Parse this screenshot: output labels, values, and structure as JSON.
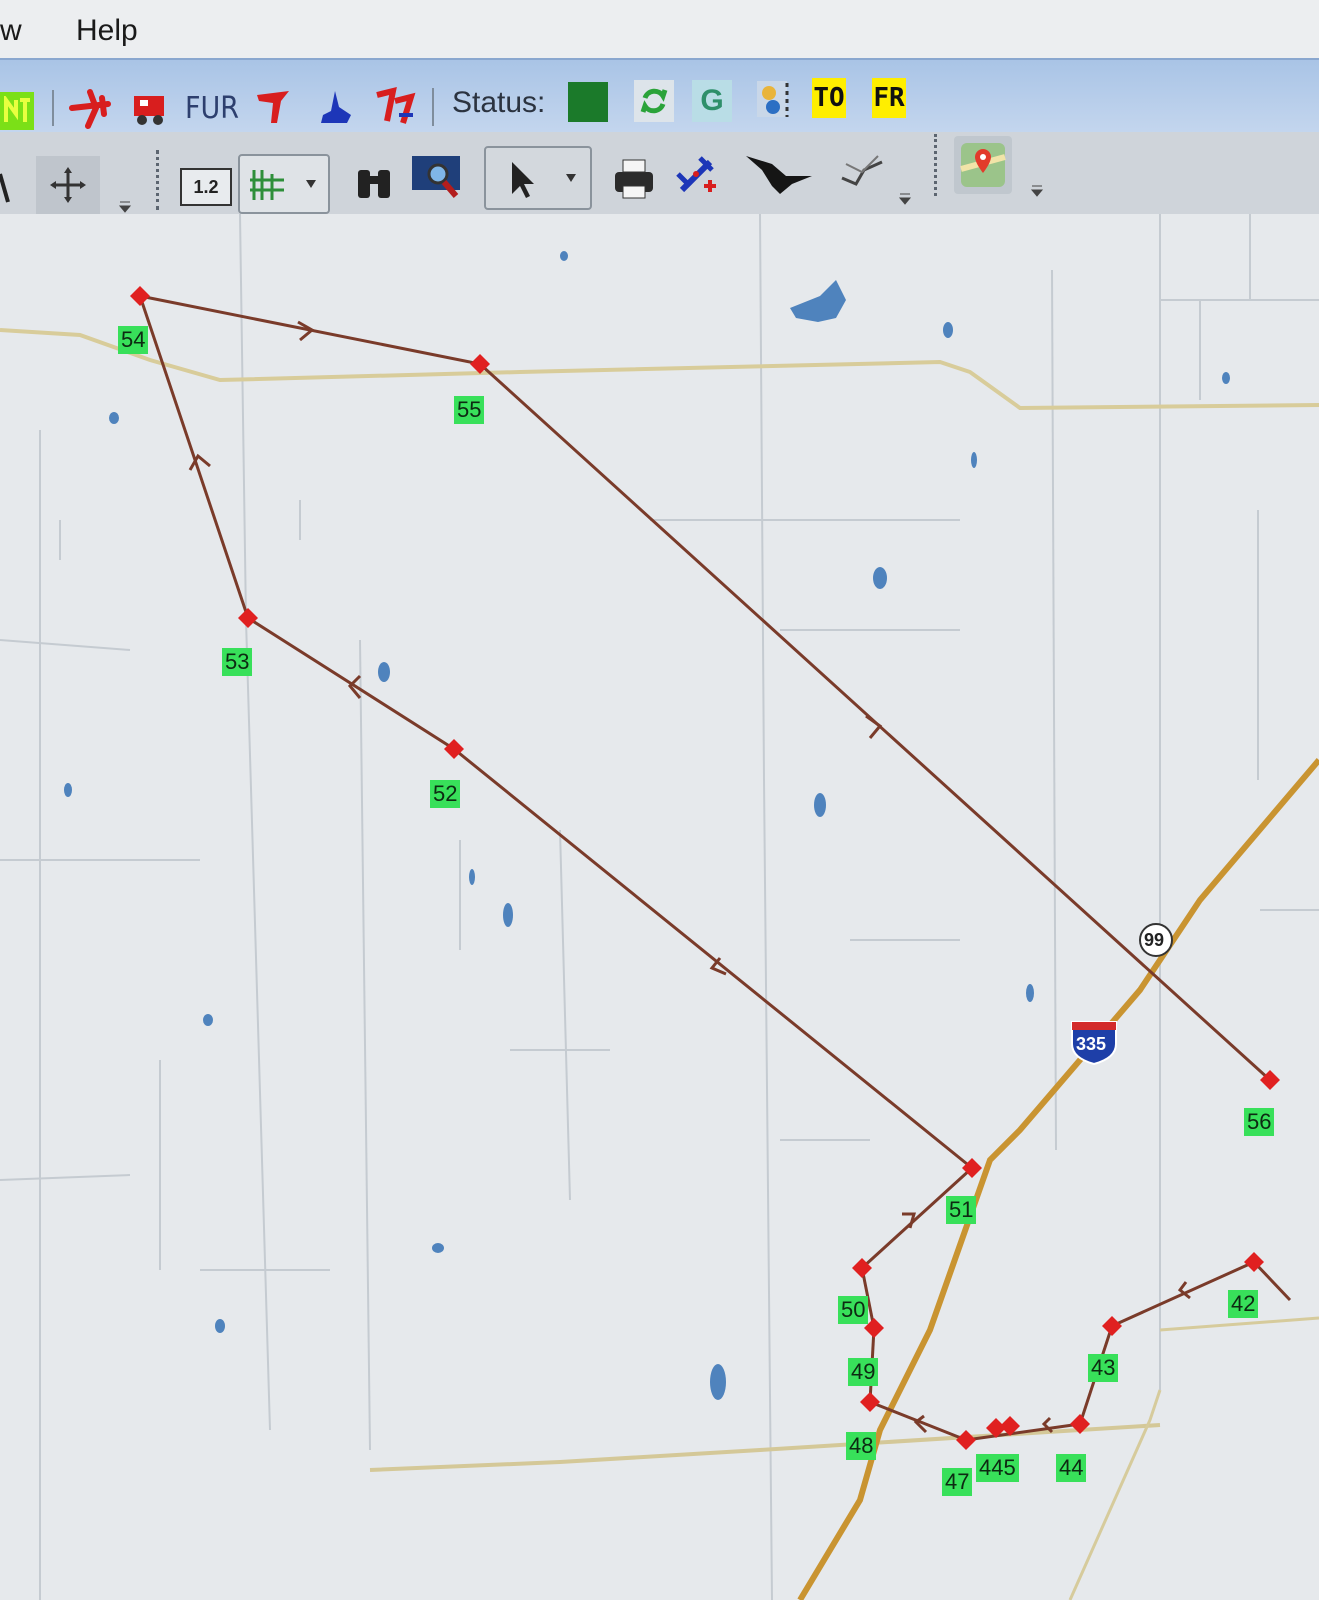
{
  "menu": {
    "view_partial": "w",
    "help": "Help"
  },
  "toolbar_top": {
    "status_label": "Status:",
    "fur_label": "FUR",
    "g_label": "G",
    "to_label": "TO",
    "fr_label": "FR",
    "status_color": "#1b7a2a"
  },
  "toolbar_bottom": {
    "ruler_label": "1.2"
  },
  "map": {
    "waypoints": [
      "54",
      "55",
      "53",
      "52",
      "51",
      "50",
      "49",
      "48",
      "47",
      "445",
      "44",
      "43",
      "42",
      "56"
    ],
    "route_shield": "99",
    "interstate_shield": "335",
    "route_color": "#7a3b2a",
    "waypoint_color": "#e02020"
  }
}
